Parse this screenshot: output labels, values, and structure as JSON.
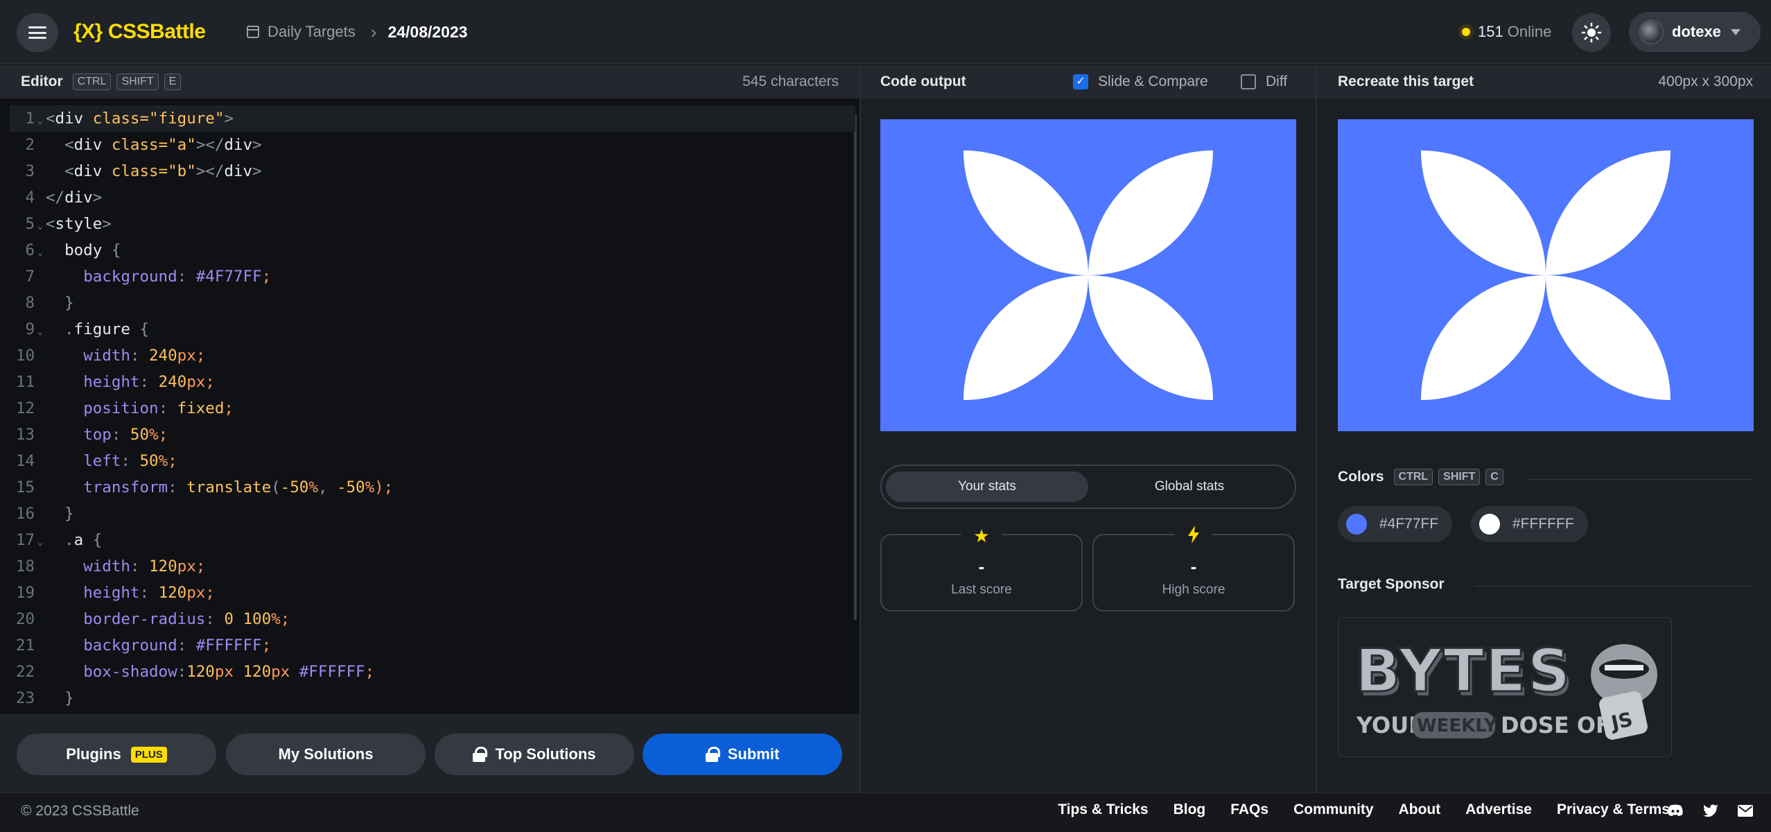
{
  "header": {
    "logo_mark": "{X}",
    "logo_text": "CSSBattle",
    "breadcrumb_parent": "Daily Targets",
    "breadcrumb_current": "24/08/2023",
    "online_count": "151",
    "online_label": "Online",
    "username": "dotexe"
  },
  "editor": {
    "title": "Editor",
    "shortcut": [
      "CTRL",
      "SHIFT",
      "E"
    ],
    "char_count": "545 characters",
    "lines": [
      {
        "n": "1",
        "fold": true
      },
      {
        "n": "2"
      },
      {
        "n": "3"
      },
      {
        "n": "4"
      },
      {
        "n": "5",
        "fold": true
      },
      {
        "n": "6",
        "fold": true
      },
      {
        "n": "7"
      },
      {
        "n": "8"
      },
      {
        "n": "9",
        "fold": true
      },
      {
        "n": "10"
      },
      {
        "n": "11"
      },
      {
        "n": "12"
      },
      {
        "n": "13"
      },
      {
        "n": "14"
      },
      {
        "n": "15"
      },
      {
        "n": "16"
      },
      {
        "n": "17",
        "fold": true
      },
      {
        "n": "18"
      },
      {
        "n": "19"
      },
      {
        "n": "20"
      },
      {
        "n": "21"
      },
      {
        "n": "22"
      },
      {
        "n": "23"
      }
    ],
    "code": {
      "l1": [
        "<",
        "div",
        " class=",
        "\"figure\"",
        ">"
      ],
      "l2": [
        "  <",
        "div",
        " class=",
        "\"a\"",
        "></",
        "div",
        ">"
      ],
      "l3": [
        "  <",
        "div",
        " class=",
        "\"b\"",
        "></",
        "div",
        ">"
      ],
      "l4": [
        "</",
        "div",
        ">"
      ],
      "l5": [
        "<",
        "style",
        ">"
      ],
      "l6": [
        "  ",
        "body",
        " {"
      ],
      "l7": [
        "    ",
        "background",
        ": ",
        "#4F77FF",
        ";"
      ],
      "l8": [
        "  }"
      ],
      "l9": [
        "  .",
        "figure",
        " {"
      ],
      "l10": [
        "    ",
        "width",
        ": ",
        "240",
        "px",
        ";"
      ],
      "l11": [
        "    ",
        "height",
        ": ",
        "240",
        "px",
        ";"
      ],
      "l12": [
        "    ",
        "position",
        ": ",
        "fixed",
        ";"
      ],
      "l13": [
        "    ",
        "top",
        ": ",
        "50",
        "%",
        ";"
      ],
      "l14": [
        "    ",
        "left",
        ": ",
        "50",
        "%",
        ";"
      ],
      "l15": [
        "    ",
        "transform",
        ": ",
        "translate",
        "(",
        "-50",
        "%",
        ", ",
        "-50",
        "%",
        ");"
      ],
      "l16": [
        "  }"
      ],
      "l17": [
        "  .",
        "a",
        " {"
      ],
      "l18": [
        "    ",
        "width",
        ": ",
        "120",
        "px",
        ";"
      ],
      "l19": [
        "    ",
        "height",
        ": ",
        "120",
        "px",
        ";"
      ],
      "l20": [
        "    ",
        "border-radius",
        ": ",
        "0",
        " ",
        "100",
        "%",
        ";"
      ],
      "l21": [
        "    ",
        "background",
        ": ",
        "#FFFFFF",
        ";"
      ],
      "l22": [
        "    ",
        "box-shadow",
        ":",
        "120",
        "px",
        " ",
        "120",
        "px",
        " ",
        "#FFFFFF",
        ";"
      ],
      "l23": [
        "  }"
      ]
    }
  },
  "actions": {
    "plugins": "Plugins",
    "plugins_badge": "PLUS",
    "my_solutions": "My Solutions",
    "top_solutions": "Top Solutions",
    "submit": "Submit"
  },
  "output": {
    "title": "Code output",
    "slide_compare": "Slide & Compare",
    "slide_compare_checked": true,
    "diff": "Diff",
    "diff_checked": false,
    "tab_your": "Your stats",
    "tab_global": "Global stats",
    "last_score_value": "-",
    "last_score_label": "Last score",
    "high_score_value": "-",
    "high_score_label": "High score"
  },
  "target": {
    "title": "Recreate this target",
    "dimensions": "400px x 300px",
    "colors_title": "Colors",
    "colors_shortcut": [
      "CTRL",
      "SHIFT",
      "C"
    ],
    "colors": [
      {
        "hex": "#4F77FF",
        "label": "#4F77FF"
      },
      {
        "hex": "#FFFFFF",
        "label": "#FFFFFF"
      }
    ],
    "sponsor_title": "Target Sponsor",
    "sponsor_word": "BYTES",
    "sponsor_tagline_1": "YOUR",
    "sponsor_tagline_2": "WEEKLY",
    "sponsor_tagline_3": "DOSE OF",
    "sponsor_badge": "JS"
  },
  "footer": {
    "copyright": "© 2023 CSSBattle",
    "links": [
      "Tips & Tricks",
      "Blog",
      "FAQs",
      "Community",
      "About",
      "Advertise",
      "Privacy & Terms"
    ]
  }
}
